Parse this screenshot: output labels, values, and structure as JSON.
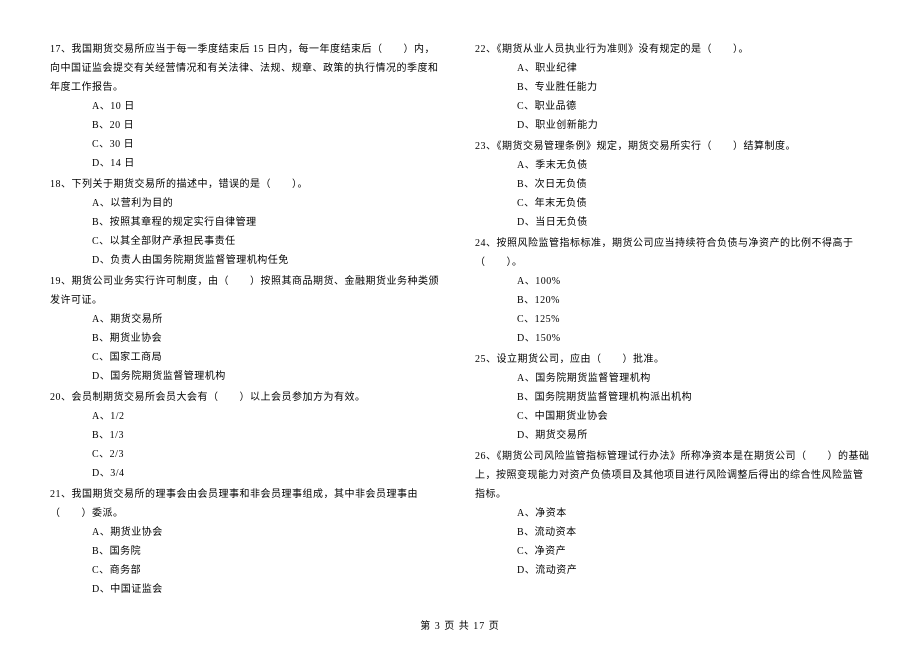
{
  "left": {
    "q17": {
      "text": "17、我国期货交易所应当于每一季度结束后 15 日内，每一年度结束后（　　）内，向中国证监会提交有关经营情况和有关法律、法规、规章、政策的执行情况的季度和年度工作报告。",
      "a": "A、10 日",
      "b": "B、20 日",
      "c": "C、30 日",
      "d": "D、14 日"
    },
    "q18": {
      "text": "18、下列关于期货交易所的描述中，错误的是（　　）。",
      "a": "A、以营利为目的",
      "b": "B、按照其章程的规定实行自律管理",
      "c": "C、以其全部财产承担民事责任",
      "d": "D、负责人由国务院期货监督管理机构任免"
    },
    "q19": {
      "text": "19、期货公司业务实行许可制度，由（　　）按照其商品期货、金融期货业务种类颁发许可证。",
      "a": "A、期货交易所",
      "b": "B、期货业协会",
      "c": "C、国家工商局",
      "d": "D、国务院期货监督管理机构"
    },
    "q20": {
      "text": "20、会员制期货交易所会员大会有（　　）以上会员参加方为有效。",
      "a": "A、1/2",
      "b": "B、1/3",
      "c": "C、2/3",
      "d": "D、3/4"
    },
    "q21": {
      "text": "21、我国期货交易所的理事会由会员理事和非会员理事组成，其中非会员理事由（　　）委派。",
      "a": "A、期货业协会",
      "b": "B、国务院",
      "c": "C、商务部",
      "d": "D、中国证监会"
    }
  },
  "right": {
    "q22": {
      "text": "22、《期货从业人员执业行为准则》没有规定的是（　　）。",
      "a": "A、职业纪律",
      "b": "B、专业胜任能力",
      "c": "C、职业品德",
      "d": "D、职业创新能力"
    },
    "q23": {
      "text": "23、《期货交易管理条例》规定，期货交易所实行（　　）结算制度。",
      "a": "A、季末无负债",
      "b": "B、次日无负债",
      "c": "C、年末无负债",
      "d": "D、当日无负债"
    },
    "q24": {
      "text": "24、按照风险监管指标标准，期货公司应当持续符合负债与净资产的比例不得高于（　　）。",
      "a": "A、100%",
      "b": "B、120%",
      "c": "C、125%",
      "d": "D、150%"
    },
    "q25": {
      "text": "25、设立期货公司，应由（　　）批准。",
      "a": "A、国务院期货监督管理机构",
      "b": "B、国务院期货监督管理机构派出机构",
      "c": "C、中国期货业协会",
      "d": "D、期货交易所"
    },
    "q26": {
      "text": "26、《期货公司风险监管指标管理试行办法》所称净资本是在期货公司（　　）的基础上，按照变现能力对资产负债项目及其他项目进行风险调整后得出的综合性风险监管指标。",
      "a": "A、净资本",
      "b": "B、流动资本",
      "c": "C、净资产",
      "d": "D、流动资产"
    }
  },
  "footer": "第 3 页 共 17 页"
}
